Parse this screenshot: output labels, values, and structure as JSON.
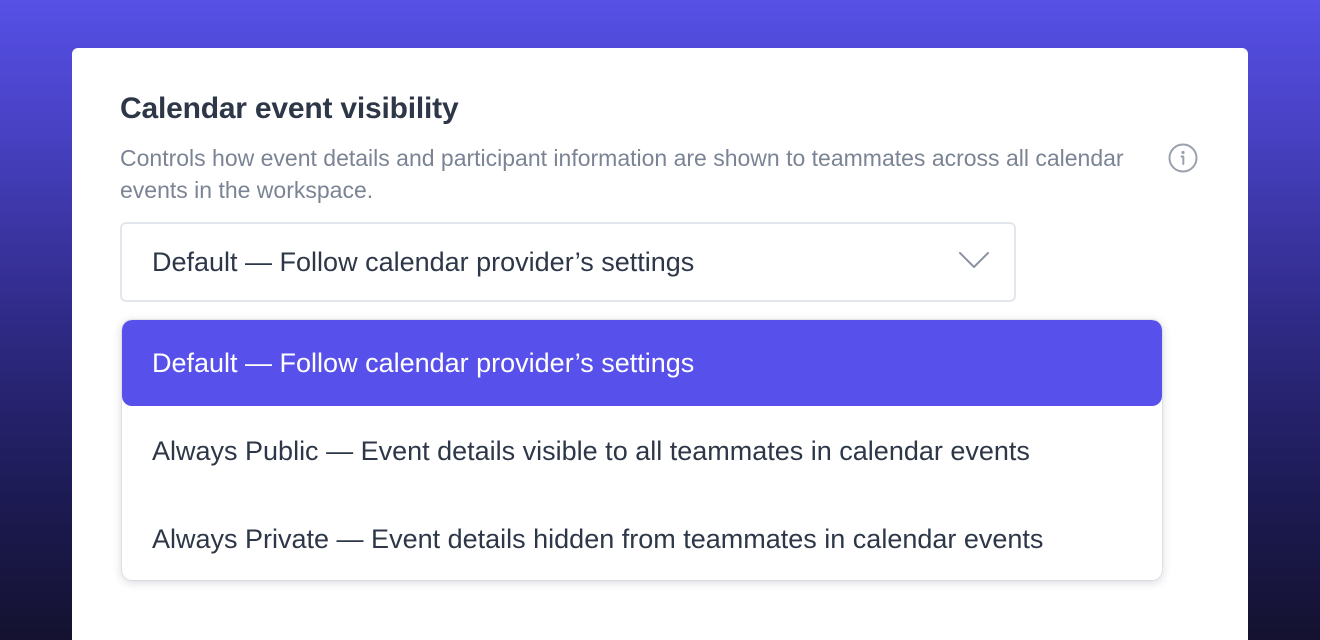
{
  "setting": {
    "title": "Calendar event visibility",
    "description": "Controls how event details and participant information are shown to teammates across all calendar events in the workspace.",
    "info_icon": "info-circle-icon"
  },
  "select": {
    "value": "Default — Follow calendar provider’s settings",
    "chevron_icon": "chevron-down-icon"
  },
  "dropdown": {
    "options": [
      {
        "label": "Default — Follow calendar provider’s settings",
        "selected": true
      },
      {
        "label": "Always Public — Event details visible to all teammates in calendar events",
        "selected": false
      },
      {
        "label": "Always Private — Event details hidden from teammates in calendar events",
        "selected": false
      }
    ]
  },
  "colors": {
    "background_top": "#5650e6",
    "background_bottom": "#14122f",
    "accent": "#5850ea",
    "title_text": "#2d3748",
    "muted_text": "#7b8494"
  }
}
